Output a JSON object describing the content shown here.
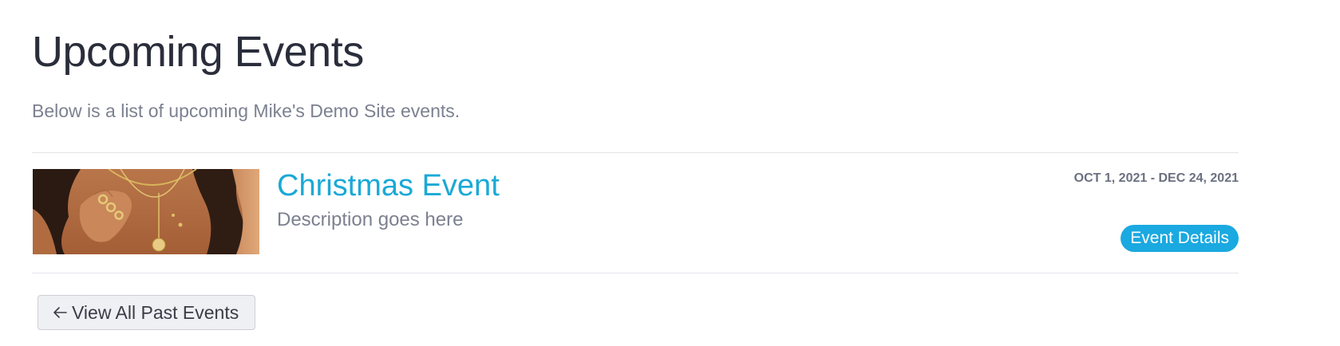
{
  "header": {
    "title": "Upcoming Events",
    "subtitle": "Below is a list of upcoming Mike's Demo Site events."
  },
  "events": [
    {
      "title": "Christmas Event",
      "description": "Description goes here",
      "date_range": "OCT 1, 2021 - DEC 24, 2021",
      "details_label": "Event Details",
      "image": "jewelry-photo"
    }
  ],
  "footer": {
    "past_events_label": "View All Past Events",
    "past_events_icon": "arrow-left-icon"
  },
  "colors": {
    "accent": "#1aa9e0",
    "title_link": "#1aa9d6",
    "heading": "#2a2d3a",
    "muted_text": "#7c8190"
  }
}
